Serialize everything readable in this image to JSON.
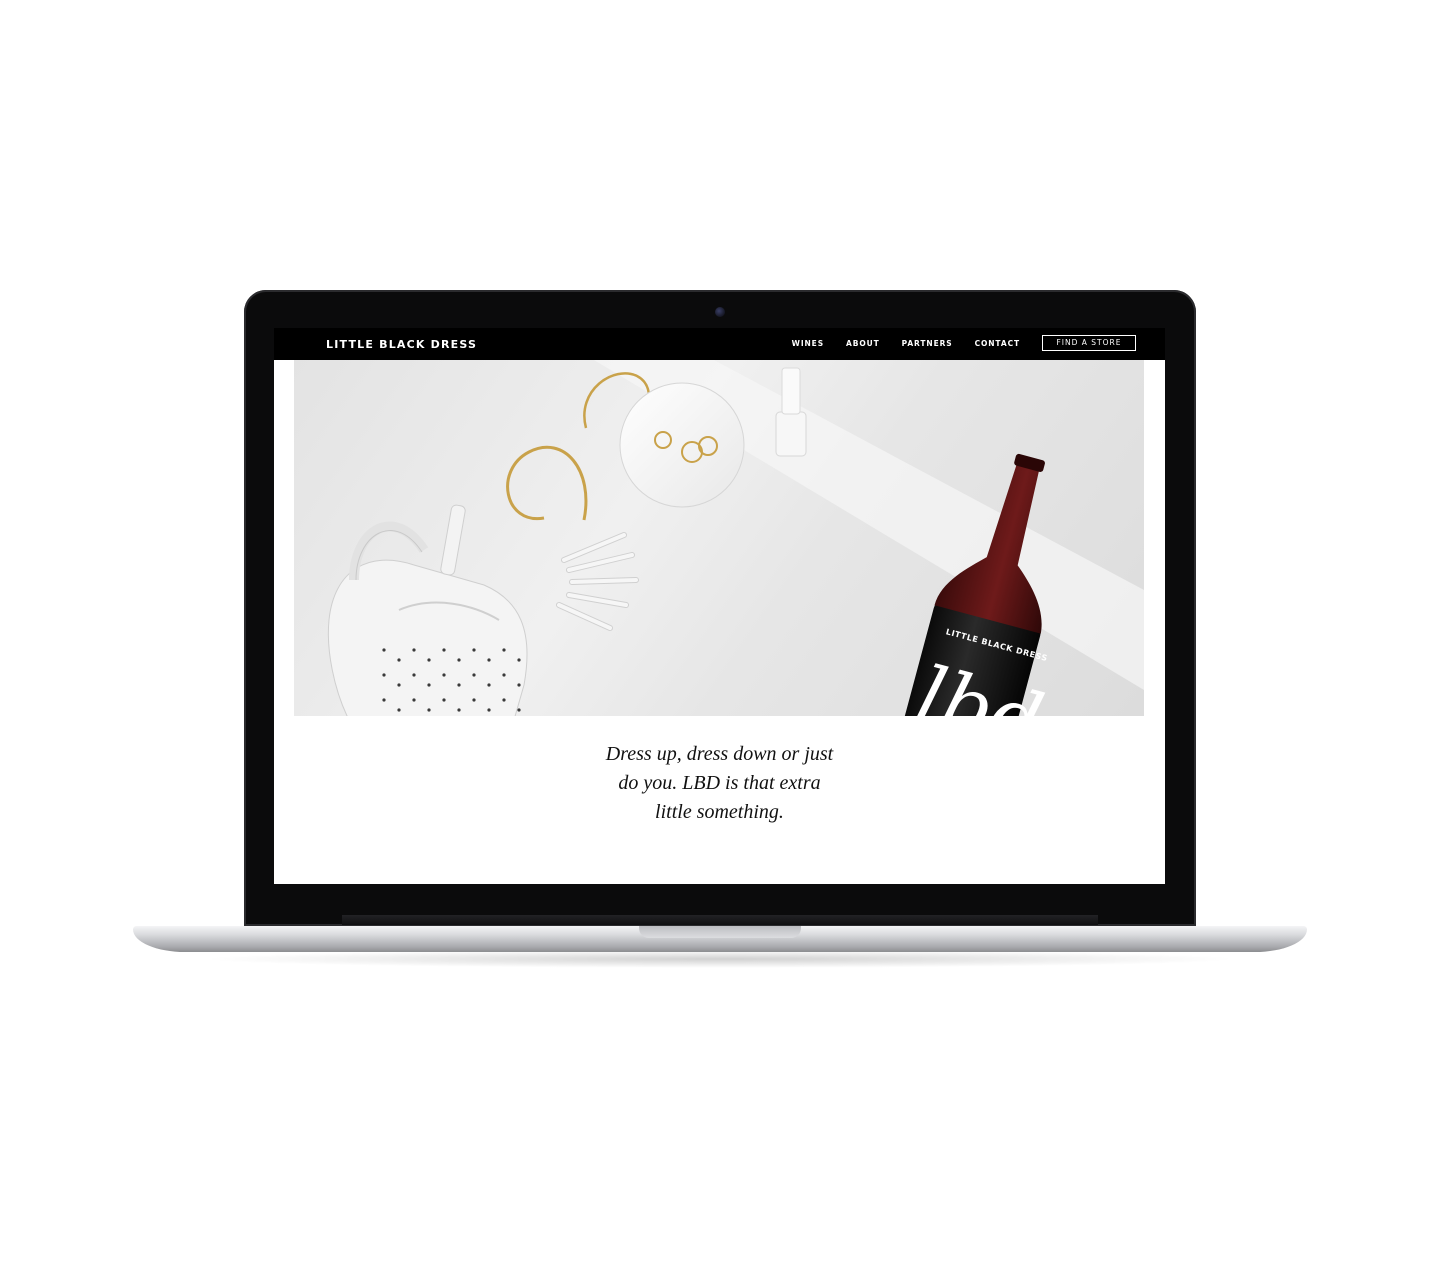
{
  "site": {
    "logo": "LITTLE BLACK DRESS",
    "nav": [
      "WINES",
      "ABOUT",
      "PARTNERS",
      "CONTACT"
    ],
    "cta": "FIND A STORE"
  },
  "hero": {
    "bottle_label_brand": "LITTLE BLACK DRESS",
    "bottle_label_script": "lbd"
  },
  "tagline": {
    "lines": [
      "Dress up, dress down or just",
      "do you. LBD is that extra",
      "little something."
    ]
  },
  "colors": {
    "nav_bg": "#000000",
    "wine_capsule": "#5a1414",
    "gold": "#c9a24a"
  }
}
